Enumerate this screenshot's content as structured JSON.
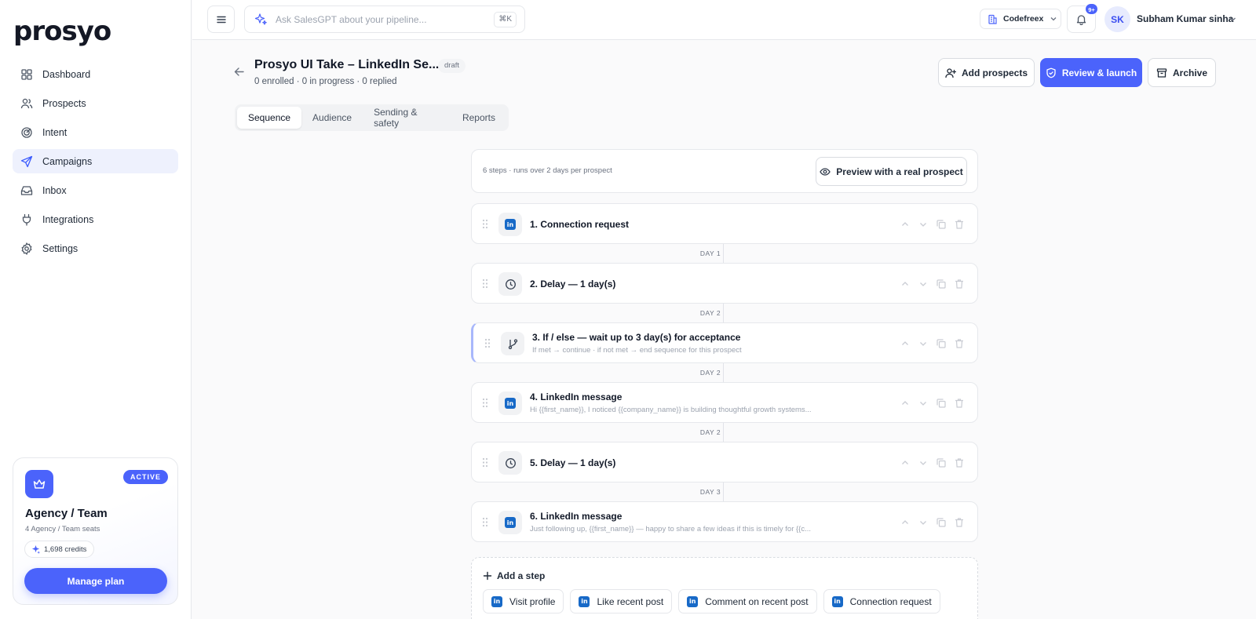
{
  "sidebar": {
    "logo": "prosyo",
    "items": [
      {
        "label": "Dashboard",
        "icon": "grid-icon"
      },
      {
        "label": "Prospects",
        "icon": "users-icon"
      },
      {
        "label": "Intent",
        "icon": "target-icon"
      },
      {
        "label": "Campaigns",
        "icon": "send-icon",
        "active": true
      },
      {
        "label": "Inbox",
        "icon": "inbox-icon"
      },
      {
        "label": "Integrations",
        "icon": "plug-icon"
      },
      {
        "label": "Settings",
        "icon": "gear-icon"
      }
    ],
    "plan": {
      "badge": "ACTIVE",
      "name": "Agency / Team",
      "seats": "4 Agency / Team seats",
      "credits": "1,698 credits",
      "manage_label": "Manage plan"
    }
  },
  "topbar": {
    "search_placeholder": "Ask SalesGPT about your pipeline...",
    "shortcut": "⌘K",
    "workspace": "Codefreex",
    "notification_count": "9+",
    "avatar_initials": "SK",
    "user_name": "Subham Kumar sinha"
  },
  "campaign": {
    "title": "Prosyo UI Take – LinkedIn Se...",
    "status": "draft",
    "stats": "0 enrolled · 0 in progress · 0 replied",
    "buttons": {
      "add_prospects": "Add prospects",
      "review_launch": "Review & launch",
      "archive": "Archive"
    },
    "tabs": [
      "Sequence",
      "Audience",
      "Sending & safety",
      "Reports"
    ],
    "active_tab": "Sequence"
  },
  "sequence": {
    "summary": "6 steps · runs over 2 days per prospect",
    "preview_label": "Preview with a real prospect",
    "steps": [
      {
        "title": "1. Connection request",
        "desc": "",
        "type": "linkedin"
      },
      {
        "title": "2. Delay — 1 day(s)",
        "desc": "",
        "type": "delay"
      },
      {
        "title": "3. If / else — wait up to 3 day(s) for acceptance",
        "desc": "If met → continue · if not met → end sequence for this prospect",
        "type": "branch"
      },
      {
        "title": "4. LinkedIn message",
        "desc": "Hi {{first_name}}, I noticed {{company_name}} is building thoughtful growth systems...",
        "type": "linkedin"
      },
      {
        "title": "5. Delay — 1 day(s)",
        "desc": "",
        "type": "delay"
      },
      {
        "title": "6. LinkedIn message",
        "desc": "Just following up, {{first_name}} — happy to share a few ideas if this is timely for {{c...",
        "type": "linkedin"
      }
    ],
    "day_labels": [
      "DAY 1",
      "DAY 2",
      "DAY 2",
      "DAY 2",
      "DAY 3"
    ],
    "add_step": {
      "title": "Add a step",
      "options": [
        "Visit profile",
        "Like recent post",
        "Comment on recent post",
        "Connection request"
      ]
    }
  },
  "colors": {
    "accent": "#4b63fb",
    "linkedin": "#1769c7",
    "active_nav_bg": "#eef1fd"
  }
}
